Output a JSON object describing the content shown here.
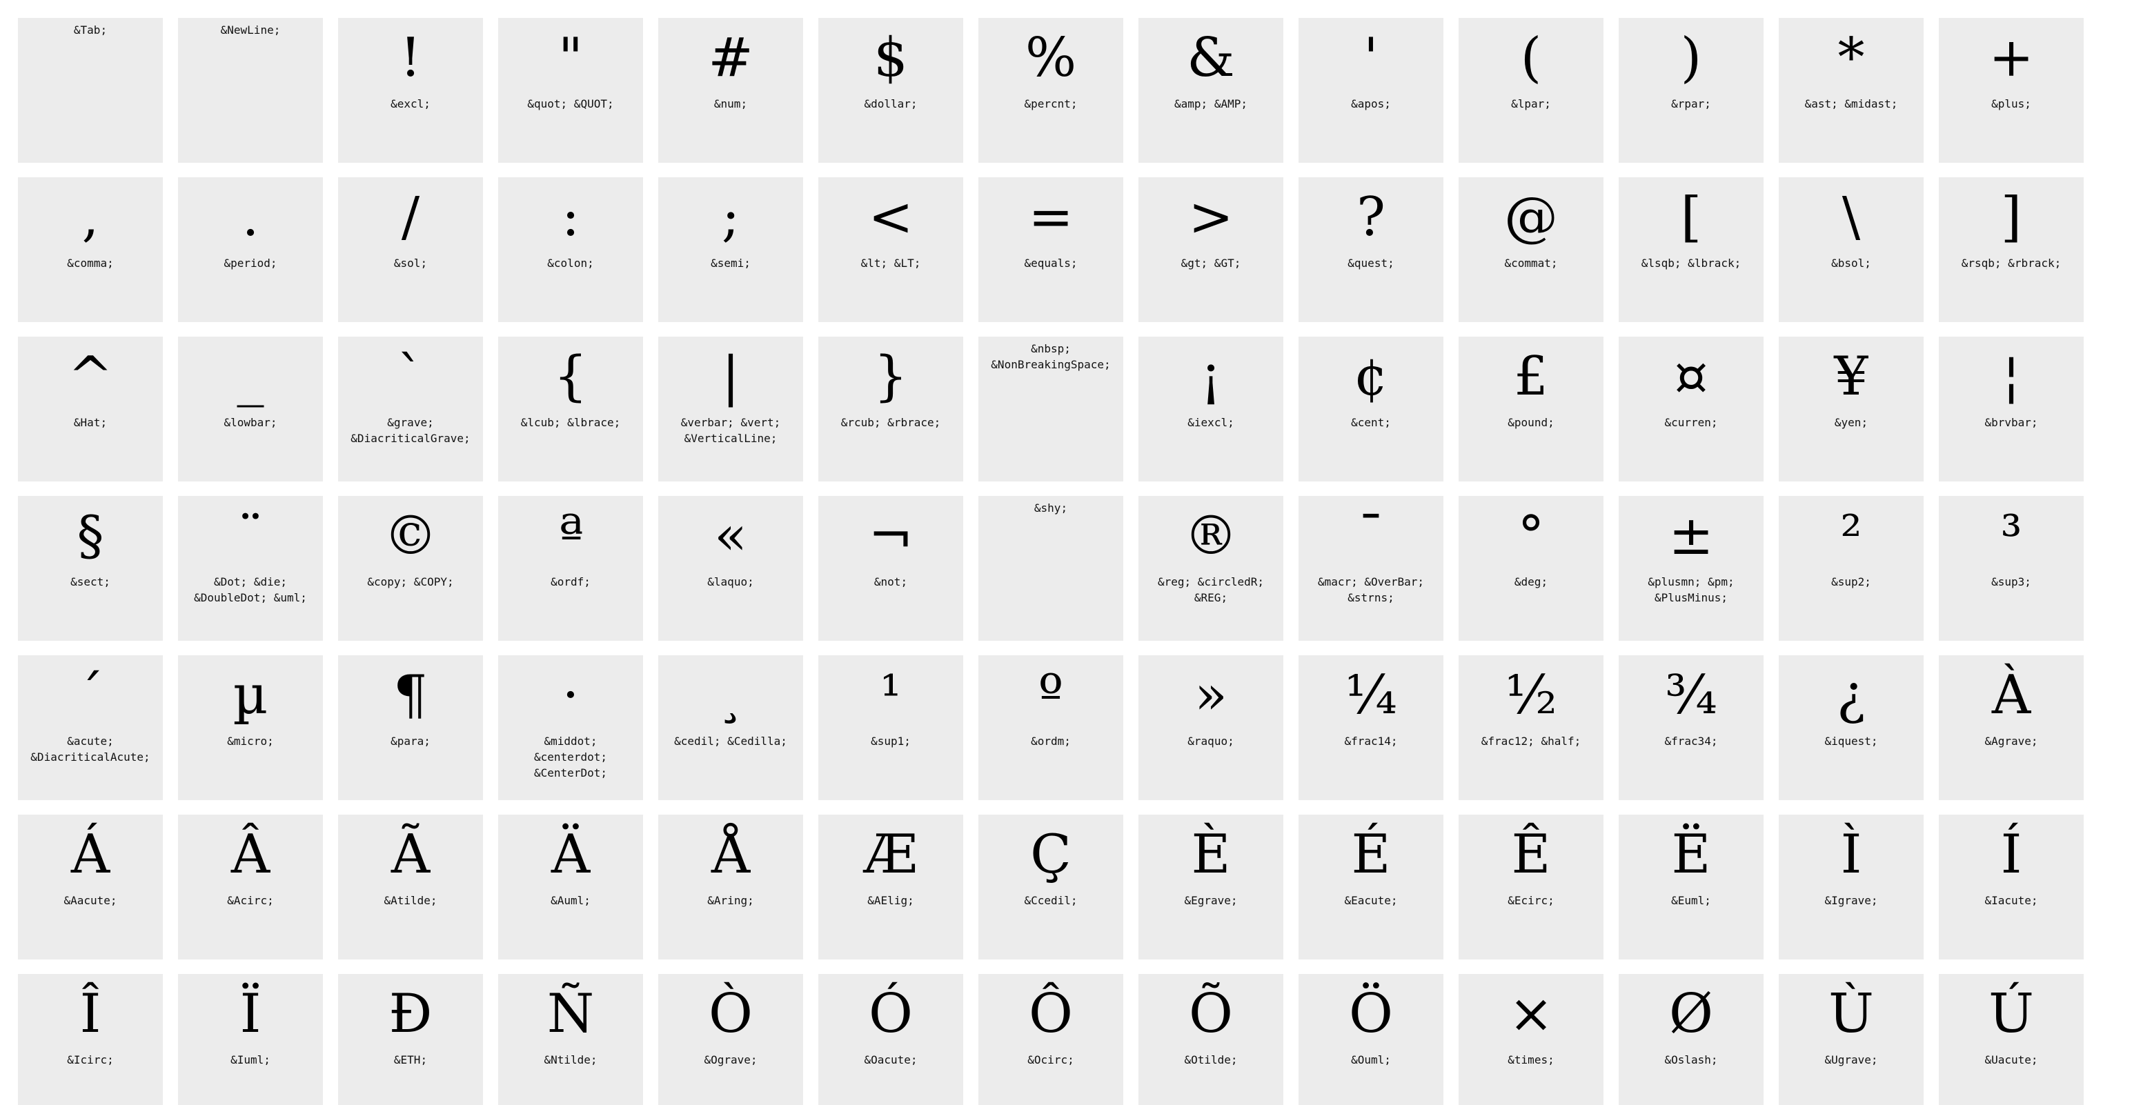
{
  "entities": [
    {
      "glyph": "",
      "names": [
        "&Tab;"
      ]
    },
    {
      "glyph": "",
      "names": [
        "&NewLine;"
      ]
    },
    {
      "glyph": "!",
      "names": [
        "&excl;"
      ]
    },
    {
      "glyph": "\"",
      "names": [
        "&quot; &QUOT;"
      ]
    },
    {
      "glyph": "#",
      "names": [
        "&num;"
      ]
    },
    {
      "glyph": "$",
      "names": [
        "&dollar;"
      ]
    },
    {
      "glyph": "%",
      "names": [
        "&percnt;"
      ]
    },
    {
      "glyph": "&",
      "names": [
        "&amp; &AMP;"
      ]
    },
    {
      "glyph": "'",
      "names": [
        "&apos;"
      ]
    },
    {
      "glyph": "(",
      "names": [
        "&lpar;"
      ]
    },
    {
      "glyph": ")",
      "names": [
        "&rpar;"
      ]
    },
    {
      "glyph": "*",
      "names": [
        "&ast; &midast;"
      ]
    },
    {
      "glyph": "+",
      "names": [
        "&plus;"
      ]
    },
    {
      "glyph": ",",
      "names": [
        "&comma;"
      ]
    },
    {
      "glyph": ".",
      "names": [
        "&period;"
      ]
    },
    {
      "glyph": "/",
      "names": [
        "&sol;"
      ]
    },
    {
      "glyph": ":",
      "names": [
        "&colon;"
      ]
    },
    {
      "glyph": ";",
      "names": [
        "&semi;"
      ]
    },
    {
      "glyph": "<",
      "names": [
        "&lt; &LT;"
      ]
    },
    {
      "glyph": "=",
      "names": [
        "&equals;"
      ]
    },
    {
      "glyph": ">",
      "names": [
        "&gt; &GT;"
      ]
    },
    {
      "glyph": "?",
      "names": [
        "&quest;"
      ]
    },
    {
      "glyph": "@",
      "names": [
        "&commat;"
      ]
    },
    {
      "glyph": "[",
      "names": [
        "&lsqb; &lbrack;"
      ]
    },
    {
      "glyph": "\\",
      "names": [
        "&bsol;"
      ]
    },
    {
      "glyph": "]",
      "names": [
        "&rsqb; &rbrack;"
      ]
    },
    {
      "glyph": "^",
      "names": [
        "&Hat;"
      ]
    },
    {
      "glyph": "_",
      "names": [
        "&lowbar;"
      ]
    },
    {
      "glyph": "`",
      "names": [
        "&grave;",
        "&DiacriticalGrave;"
      ]
    },
    {
      "glyph": "{",
      "names": [
        "&lcub; &lbrace;"
      ]
    },
    {
      "glyph": "|",
      "names": [
        "&verbar; &vert;",
        "&VerticalLine;"
      ]
    },
    {
      "glyph": "}",
      "names": [
        "&rcub; &rbrace;"
      ]
    },
    {
      "glyph": "",
      "names": [
        "&nbsp;",
        "&NonBreakingSpace;"
      ]
    },
    {
      "glyph": "¡",
      "names": [
        "&iexcl;"
      ]
    },
    {
      "glyph": "¢",
      "names": [
        "&cent;"
      ]
    },
    {
      "glyph": "£",
      "names": [
        "&pound;"
      ]
    },
    {
      "glyph": "¤",
      "names": [
        "&curren;"
      ]
    },
    {
      "glyph": "¥",
      "names": [
        "&yen;"
      ]
    },
    {
      "glyph": "¦",
      "names": [
        "&brvbar;"
      ]
    },
    {
      "glyph": "§",
      "names": [
        "&sect;"
      ]
    },
    {
      "glyph": "¨",
      "names": [
        "&Dot; &die;",
        "&DoubleDot; &uml;"
      ]
    },
    {
      "glyph": "©",
      "names": [
        "&copy; &COPY;"
      ]
    },
    {
      "glyph": "ª",
      "names": [
        "&ordf;"
      ]
    },
    {
      "glyph": "«",
      "names": [
        "&laquo;"
      ]
    },
    {
      "glyph": "¬",
      "names": [
        "&not;"
      ]
    },
    {
      "glyph": "",
      "names": [
        "&shy;"
      ]
    },
    {
      "glyph": "®",
      "names": [
        "&reg; &circledR;",
        "&REG;"
      ]
    },
    {
      "glyph": "¯",
      "names": [
        "&macr; &OverBar;",
        "&strns;"
      ]
    },
    {
      "glyph": "°",
      "names": [
        "&deg;"
      ]
    },
    {
      "glyph": "±",
      "names": [
        "&plusmn; &pm;",
        "&PlusMinus;"
      ]
    },
    {
      "glyph": "²",
      "names": [
        "&sup2;"
      ]
    },
    {
      "glyph": "³",
      "names": [
        "&sup3;"
      ]
    },
    {
      "glyph": "´",
      "names": [
        "&acute;",
        "&DiacriticalAcute;"
      ]
    },
    {
      "glyph": "µ",
      "names": [
        "&micro;"
      ]
    },
    {
      "glyph": "¶",
      "names": [
        "&para;"
      ]
    },
    {
      "glyph": "·",
      "names": [
        "&middot;",
        "&centerdot;",
        "&CenterDot;"
      ]
    },
    {
      "glyph": "¸",
      "names": [
        "&cedil; &Cedilla;"
      ]
    },
    {
      "glyph": "¹",
      "names": [
        "&sup1;"
      ]
    },
    {
      "glyph": "º",
      "names": [
        "&ordm;"
      ]
    },
    {
      "glyph": "»",
      "names": [
        "&raquo;"
      ]
    },
    {
      "glyph": "¼",
      "names": [
        "&frac14;"
      ]
    },
    {
      "glyph": "½",
      "names": [
        "&frac12; &half;"
      ]
    },
    {
      "glyph": "¾",
      "names": [
        "&frac34;"
      ]
    },
    {
      "glyph": "¿",
      "names": [
        "&iquest;"
      ]
    },
    {
      "glyph": "À",
      "names": [
        "&Agrave;"
      ]
    },
    {
      "glyph": "Á",
      "names": [
        "&Aacute;"
      ]
    },
    {
      "glyph": "Â",
      "names": [
        "&Acirc;"
      ]
    },
    {
      "glyph": "Ã",
      "names": [
        "&Atilde;"
      ]
    },
    {
      "glyph": "Ä",
      "names": [
        "&Auml;"
      ]
    },
    {
      "glyph": "Å",
      "names": [
        "&Aring;"
      ]
    },
    {
      "glyph": "Æ",
      "names": [
        "&AElig;"
      ]
    },
    {
      "glyph": "Ç",
      "names": [
        "&Ccedil;"
      ]
    },
    {
      "glyph": "È",
      "names": [
        "&Egrave;"
      ]
    },
    {
      "glyph": "É",
      "names": [
        "&Eacute;"
      ]
    },
    {
      "glyph": "Ê",
      "names": [
        "&Ecirc;"
      ]
    },
    {
      "glyph": "Ë",
      "names": [
        "&Euml;"
      ]
    },
    {
      "glyph": "Ì",
      "names": [
        "&Igrave;"
      ]
    },
    {
      "glyph": "Í",
      "names": [
        "&Iacute;"
      ]
    },
    {
      "glyph": "Î",
      "names": [
        "&Icirc;"
      ]
    },
    {
      "glyph": "Ï",
      "names": [
        "&Iuml;"
      ]
    },
    {
      "glyph": "Ð",
      "names": [
        "&ETH;"
      ]
    },
    {
      "glyph": "Ñ",
      "names": [
        "&Ntilde;"
      ]
    },
    {
      "glyph": "Ò",
      "names": [
        "&Ograve;"
      ]
    },
    {
      "glyph": "Ó",
      "names": [
        "&Oacute;"
      ]
    },
    {
      "glyph": "Ô",
      "names": [
        "&Ocirc;"
      ]
    },
    {
      "glyph": "Õ",
      "names": [
        "&Otilde;"
      ]
    },
    {
      "glyph": "Ö",
      "names": [
        "&Ouml;"
      ]
    },
    {
      "glyph": "×",
      "names": [
        "&times;"
      ]
    },
    {
      "glyph": "Ø",
      "names": [
        "&Oslash;"
      ]
    },
    {
      "glyph": "Ù",
      "names": [
        "&Ugrave;"
      ]
    },
    {
      "glyph": "Ú",
      "names": [
        "&Uacute;"
      ]
    }
  ]
}
